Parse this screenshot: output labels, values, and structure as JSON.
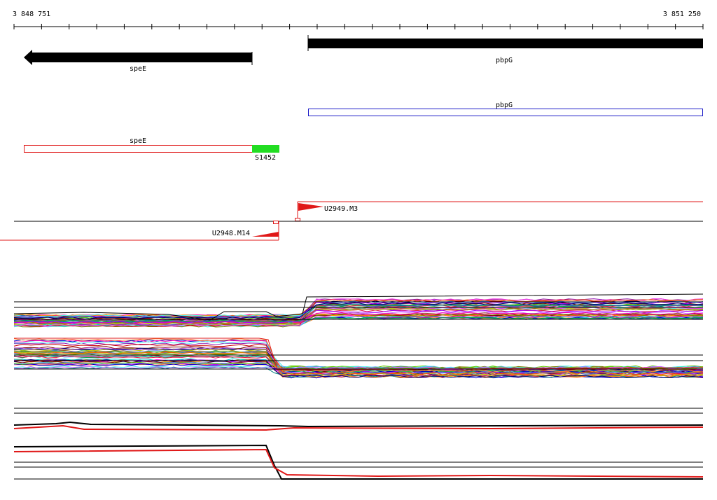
{
  "ruler": {
    "start_label": "3 848 751",
    "end_label": "3 851 250"
  },
  "genes": [
    {
      "name": "speE",
      "strand": "-"
    },
    {
      "name": "pbpG",
      "strand": "+"
    }
  ],
  "annotations": [
    {
      "name": "pbpG",
      "outline_color": "#1c1cc8"
    },
    {
      "name": "speE",
      "outline_color": "#e01818"
    },
    {
      "name": "S1452",
      "fill_color": "#22dd22"
    }
  ],
  "transcripts": [
    {
      "name": "U2949.M3",
      "strand": "+"
    },
    {
      "name": "U2948.M14",
      "strand": "-"
    }
  ],
  "colors": {
    "gene_arrow": "#000000",
    "transcript": "#e01818",
    "axis": "#000000"
  }
}
